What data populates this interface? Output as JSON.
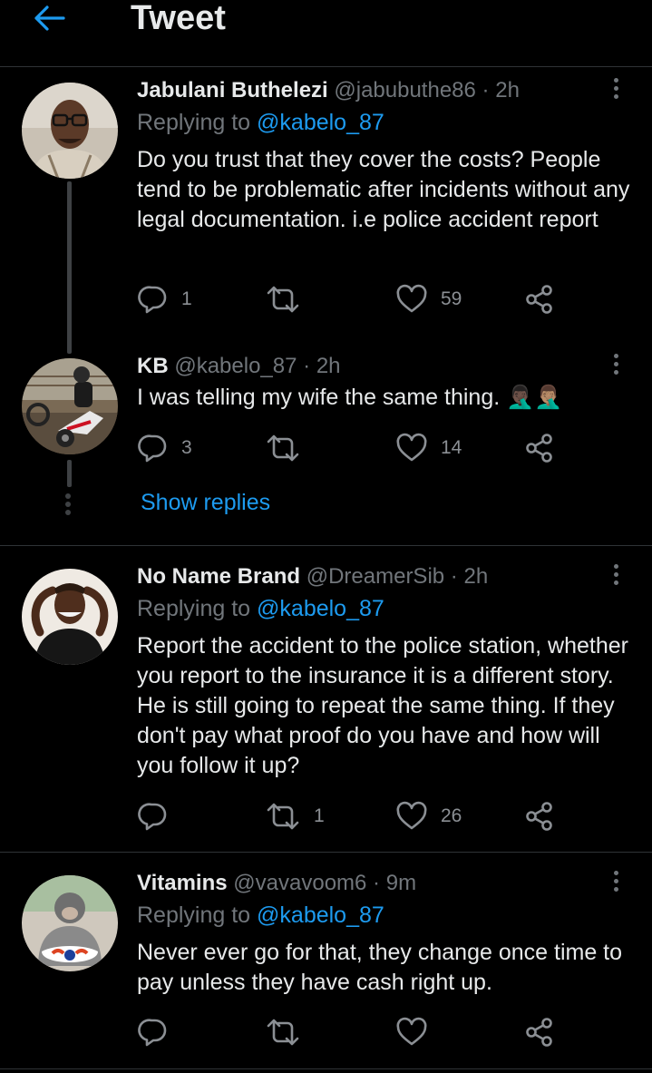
{
  "header": {
    "title": "Tweet",
    "back_icon": "arrow-left-icon",
    "accent": "#1d9bf0"
  },
  "tweets": [
    {
      "name": "Jabulani Buthelezi",
      "handle": "@jabubuthe86",
      "sep": "·",
      "time": "2h",
      "replying_prefix": "Replying to",
      "replying_to": "@kabelo_87",
      "text": "Do you trust that they cover the costs? People tend to be problematic after incidents without any legal documentation.  i.e police accident report",
      "replies": "1",
      "retweets": "",
      "likes": "59"
    },
    {
      "name": "KB",
      "handle": "@kabelo_87",
      "sep": "·",
      "time": "2h",
      "text": "I was telling my wife the same thing. 🤦🏿‍♂️🤦🏽‍♂️",
      "replies": "3",
      "retweets": "",
      "likes": "14"
    },
    {
      "name": "No Name Brand",
      "handle": "@DreamerSib",
      "sep": "·",
      "time": "2h",
      "replying_prefix": "Replying to",
      "replying_to": "@kabelo_87",
      "text": "Report the accident to the police station, whether you report to the insurance it is a different story. He is still going to repeat the same thing. If they don't pay what proof do you have and how will you follow it up?",
      "replies": "",
      "retweets": "1",
      "likes": "26"
    },
    {
      "name": "Vitamins",
      "handle": "@vavavoom6",
      "sep": "·",
      "time": "9m",
      "replying_prefix": "Replying to",
      "replying_to": "@kabelo_87",
      "text": "Never ever go for that, they change once time to pay unless they have cash right up.",
      "replies": "",
      "retweets": "",
      "likes": ""
    }
  ],
  "show_replies": "Show replies",
  "colors": {
    "background": "#000000",
    "text": "#e7e9ea",
    "muted": "#71767b",
    "link": "#1d9bf0",
    "divider": "#2f3336"
  }
}
